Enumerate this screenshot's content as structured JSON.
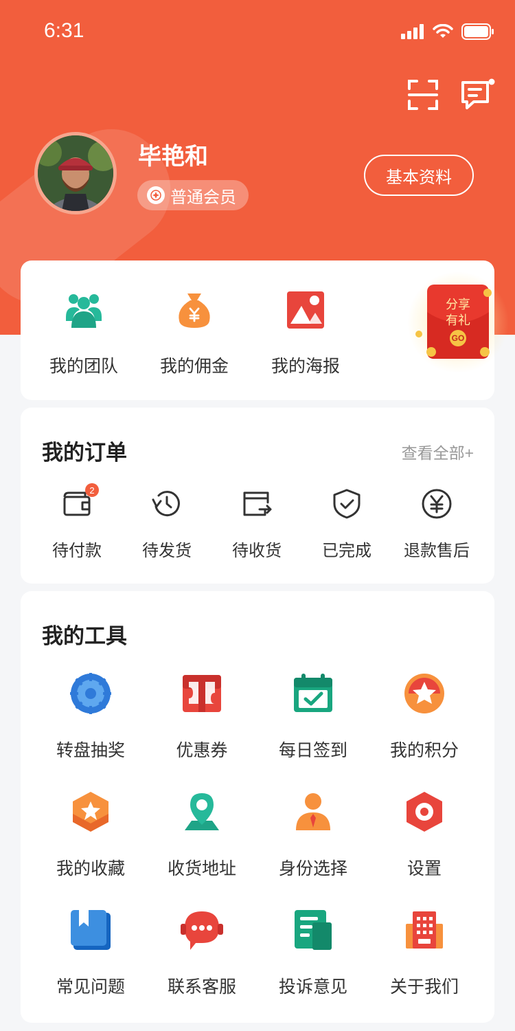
{
  "status_bar": {
    "time": "6:31",
    "signal_icon": "signal-bars-icon",
    "wifi_icon": "wifi-icon",
    "battery_icon": "battery-icon"
  },
  "header": {
    "scan_icon": "scan-icon",
    "message_icon": "message-icon",
    "username": "毕艳和",
    "member_level": "普通会员",
    "profile_button": "基本资料",
    "brand_color": "#F25E3D"
  },
  "quick_entries": [
    {
      "label": "我的团队",
      "icon": "team-icon",
      "color": "#26B99A"
    },
    {
      "label": "我的佣金",
      "icon": "money-bag-icon",
      "color": "#F7913D"
    },
    {
      "label": "我的海报",
      "icon": "poster-icon",
      "color": "#E8453C"
    }
  ],
  "share_gift": {
    "line1": "分享",
    "line2": "有礼",
    "go": "GO"
  },
  "orders": {
    "title": "我的订单",
    "view_all": "查看全部+",
    "items": [
      {
        "label": "待付款",
        "icon": "wallet-icon",
        "badge": "2"
      },
      {
        "label": "待发货",
        "icon": "clock-refresh-icon"
      },
      {
        "label": "待收货",
        "icon": "delivery-card-icon"
      },
      {
        "label": "已完成",
        "icon": "shield-check-icon"
      },
      {
        "label": "退款售后",
        "icon": "yen-circle-icon"
      }
    ]
  },
  "tools": {
    "title": "我的工具",
    "items": [
      {
        "label": "转盘抽奖",
        "icon": "wheel-icon"
      },
      {
        "label": "优惠券",
        "icon": "coupon-icon"
      },
      {
        "label": "每日签到",
        "icon": "calendar-check-icon"
      },
      {
        "label": "我的积分",
        "icon": "star-badge-icon"
      },
      {
        "label": "我的收藏",
        "icon": "favorite-hexagon-icon"
      },
      {
        "label": "收货地址",
        "icon": "location-pin-icon"
      },
      {
        "label": "身份选择",
        "icon": "person-icon"
      },
      {
        "label": "设置",
        "icon": "settings-icon"
      },
      {
        "label": "常见问题",
        "icon": "bookmark-book-icon"
      },
      {
        "label": "联系客服",
        "icon": "headset-icon"
      },
      {
        "label": "投诉意见",
        "icon": "document-icon"
      },
      {
        "label": "关于我们",
        "icon": "building-icon"
      }
    ]
  }
}
